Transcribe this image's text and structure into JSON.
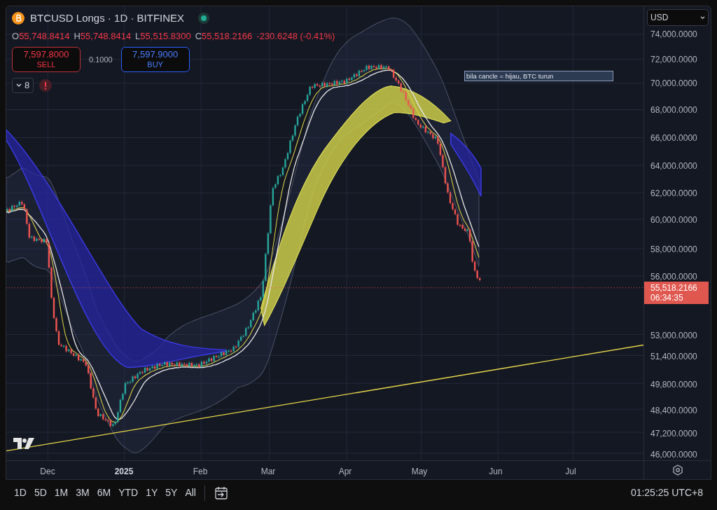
{
  "symbol": {
    "title": "BTCUSD Longs · 1D · BITFINEX"
  },
  "ohlc": [
    {
      "label": "O",
      "value": "55,748.8414"
    },
    {
      "label": "H",
      "value": "55,748.8414"
    },
    {
      "label": "L",
      "value": "55,515.8300"
    },
    {
      "label": "C",
      "value": "55,518.2166"
    }
  ],
  "change": "-230.6248 (-0.41%)",
  "trade": {
    "sell": {
      "price": "7,597.8000",
      "label": "SELL"
    },
    "spread": "0.1000",
    "buy": {
      "price": "7,597.9000",
      "label": "BUY"
    }
  },
  "indicators_count": "8",
  "note": "bila cancle = hijau, BTC turun",
  "currency": "USD",
  "price_axis": [
    "74,000.0000",
    "72,000.0000",
    "70,000.0000",
    "68,000.0000",
    "66,000.0000",
    "64,000.0000",
    "62,000.0000",
    "60,000.0000",
    "58,000.0000",
    "56,000.0000",
    "53,000.0000",
    "51,400.0000",
    "49,800.0000",
    "48,400.0000",
    "47,200.0000",
    "46,000.0000"
  ],
  "last_price": {
    "value": "55,518.2166",
    "countdown": "06:34:35"
  },
  "time_axis": [
    {
      "label": "Dec",
      "bold": false
    },
    {
      "label": "2025",
      "bold": true
    },
    {
      "label": "Feb",
      "bold": false
    },
    {
      "label": "Mar",
      "bold": false
    },
    {
      "label": "Apr",
      "bold": false
    },
    {
      "label": "May",
      "bold": false
    },
    {
      "label": "Jun",
      "bold": false
    },
    {
      "label": "Jul",
      "bold": false
    }
  ],
  "ranges": [
    "1D",
    "5D",
    "1M",
    "3M",
    "6M",
    "YTD",
    "1Y",
    "5Y",
    "All"
  ],
  "clock": "01:25:25 UTC+8"
}
